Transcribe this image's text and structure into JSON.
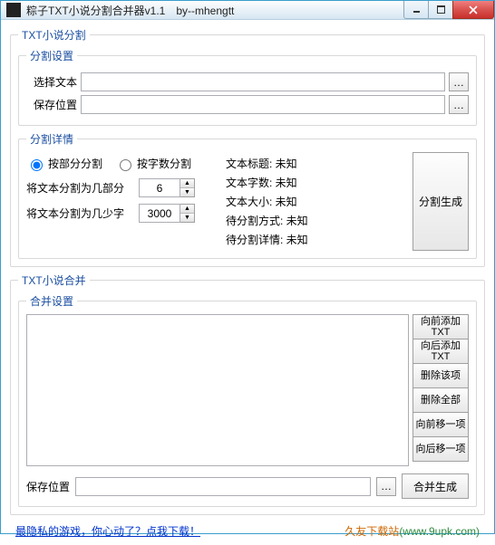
{
  "window": {
    "title": "粽子TXT小说分割合并器v1.1　by--mhengtt"
  },
  "split": {
    "group": "TXT小说分割",
    "settings_group": "分割设置",
    "select_text_label": "选择文本",
    "save_path_label": "保存位置",
    "select_text_value": "",
    "save_path_value": "",
    "details_group": "分割详情",
    "radio_part": "按部分分割",
    "radio_words": "按字数分割",
    "parts_label": "将文本分割为几部分",
    "parts_value": "6",
    "words_label": "将文本分割为几少字",
    "words_value": "3000",
    "info_title": "文本标题: 未知",
    "info_words": "文本字数: 未知",
    "info_size": "文本大小: 未知",
    "info_method": "待分割方式: 未知",
    "info_detail": "待分割详情: 未知",
    "generate_btn": "分割生成"
  },
  "merge": {
    "group": "TXT小说合并",
    "settings_group": "合并设置",
    "btn_add_before": "向前添加TXT",
    "btn_add_after": "向后添加TXT",
    "btn_delete": "删除该项",
    "btn_delete_all": "删除全部",
    "btn_move_up": "向前移一项",
    "btn_move_down": "向后移一项",
    "save_path_label": "保存位置",
    "save_path_value": "",
    "generate_btn": "合并生成"
  },
  "footer": {
    "link": "最隐私的游戏，你心动了？点我下载！",
    "site_cn": "久友下载站",
    "site_url": "(www.9upk.com)"
  }
}
